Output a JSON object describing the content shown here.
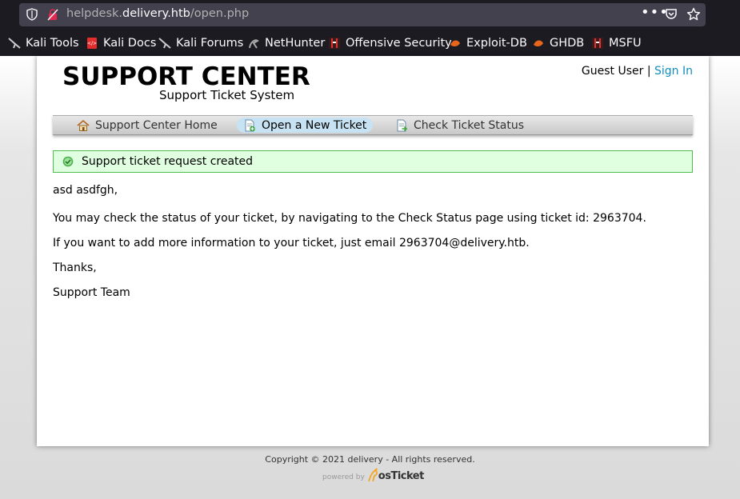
{
  "browser": {
    "url_prefix": "helpdesk.",
    "url_host": "delivery.htb",
    "url_path": "/open.php",
    "bookmarks": [
      {
        "label": "Kali Tools",
        "icon": "kali-dragon-icon"
      },
      {
        "label": "Kali Docs",
        "icon": "kali-docs-icon"
      },
      {
        "label": "Kali Forums",
        "icon": "kali-dragon-icon"
      },
      {
        "label": "NetHunter",
        "icon": "nethunter-icon"
      },
      {
        "label": "Offensive Security",
        "icon": "offsec-icon"
      },
      {
        "label": "Exploit-DB",
        "icon": "exploitdb-icon"
      },
      {
        "label": "GHDB",
        "icon": "ghdb-icon"
      },
      {
        "label": "MSFU",
        "icon": "offsec-icon"
      }
    ]
  },
  "header": {
    "logo_title": "SUPPORT CENTER",
    "logo_subtitle": "Support Ticket System",
    "user": "Guest User",
    "separator": "|",
    "sign_in": "Sign In"
  },
  "nav": {
    "items": [
      {
        "label": "Support Center Home",
        "icon": "home-icon"
      },
      {
        "label": "Open a New Ticket",
        "icon": "new-ticket-icon",
        "active": true
      },
      {
        "label": "Check Ticket Status",
        "icon": "ticket-status-icon"
      }
    ]
  },
  "notice": {
    "text": "Support ticket request created",
    "color": "#e0ffe0"
  },
  "message": {
    "greeting": "asd asdfgh,",
    "line1": "You may check the status of your ticket, by navigating to the Check Status page using ticket id: 2963704.",
    "line2": "If you want to add more information to your ticket, just email 2963704@delivery.htb.",
    "thanks": "Thanks,",
    "signature": "Support Team"
  },
  "footer": {
    "copyright": "Copyright © 2021 delivery - All rights reserved.",
    "powered_by": "powered by",
    "brand": "osTicket"
  },
  "colors": {
    "link": "#128dbe",
    "active_tab": "#c7e3f3"
  }
}
